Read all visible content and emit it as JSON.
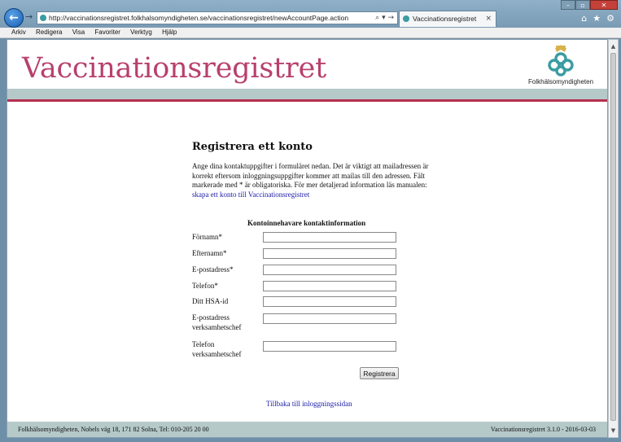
{
  "browser": {
    "url": "http://vaccinationsregistret.folkhalsomyndigheten.se/vaccinationsregistret/newAccountPage.action",
    "address_tools": "⌕ ▾ →",
    "tab_title": "Vaccinationsregistret",
    "tab_close": "×",
    "window_buttons": {
      "minimize": "–",
      "maximize": "▫",
      "close": "✕"
    },
    "tool_icons": {
      "home": "⌂",
      "favorites": "★",
      "settings": "⚙"
    }
  },
  "menu": [
    "Arkiv",
    "Redigera",
    "Visa",
    "Favoriter",
    "Verktyg",
    "Hjälp"
  ],
  "header": {
    "site_title": "Vaccinationsregistret",
    "logo_text": "Folkhälsomyndigheten"
  },
  "content": {
    "heading": "Registrera ett konto",
    "intro_text": "Ange dina kontaktuppgifter i formuläret nedan. Det är viktigt att mailadressen är korrekt eftersom inloggningsuppgifter kommer att mailas till den adressen. Fält markerade med * är obligatoriska. För mer detaljerad information läs manualen:",
    "intro_link": "skapa ett konto till Vaccinationsregistret",
    "form_heading": "Kontoinnehavare kontaktinformation",
    "fields": [
      {
        "label": "Förnamn*",
        "value": ""
      },
      {
        "label": "Efternamn*",
        "value": ""
      },
      {
        "label": "E-postadress*",
        "value": ""
      },
      {
        "label": "Telefon*",
        "value": ""
      },
      {
        "label": "Ditt HSA-id",
        "value": ""
      },
      {
        "label": "E-postadress verksamhetschef",
        "value": ""
      },
      {
        "label": "Telefon verksamhetschef",
        "value": ""
      }
    ],
    "submit_label": "Registrera",
    "back_link": "Tillbaka till inloggningssidan"
  },
  "footer": {
    "left": "Folkhälsomyndigheten, Nobels väg 18, 171 82 Solna, Tel: 010-205 20 00",
    "right": "Vaccinationsregistret 3.1.0 - 2016-03-03"
  },
  "colors": {
    "title": "#b8406d",
    "band": "#b5c9c9",
    "accent_line": "#b4304e",
    "logo_teal": "#3a9ca1",
    "logo_gold": "#d8b24a"
  }
}
